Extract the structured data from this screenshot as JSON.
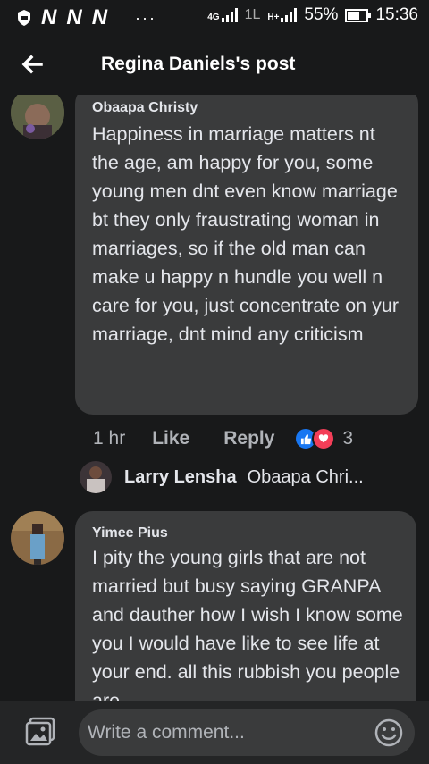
{
  "status": {
    "carrier_logos": [
      "N",
      "N",
      "N"
    ],
    "more": "···",
    "signal1": "4G",
    "signal2": "1L",
    "signal3": "H+",
    "battery_text": "55%",
    "battery_level": 0.55,
    "time": "15:36"
  },
  "header": {
    "title": "Regina Daniels's post"
  },
  "comments": [
    {
      "author": "Obaapa Christy",
      "text": "Happiness in marriage matters nt the age, am happy for you, some young men dnt even know marriage bt they only fraustrating woman in marriages, so if the old man can make u happy n hundle you well n care for you, just concentrate on yur marriage, dnt mind any criticism",
      "time": "1 hr",
      "like_label": "Like",
      "reply_label": "Reply",
      "reaction_count": "3"
    },
    {
      "author": "Yimee Pius",
      "text": "I pity the young girls that are not married but busy saying GRANPA and dauther how I wish I know some you I would have like to see life at your end. all this rubbish you people are"
    }
  ],
  "reply_preview": {
    "author": "Larry Lensha",
    "text": "Obaapa Chri..."
  },
  "composer": {
    "placeholder": "Write a comment..."
  },
  "colors": {
    "like_blue": "#1877f2",
    "love_red": "#f33e58",
    "bubble": "#3a3b3c",
    "background": "#18191a"
  }
}
